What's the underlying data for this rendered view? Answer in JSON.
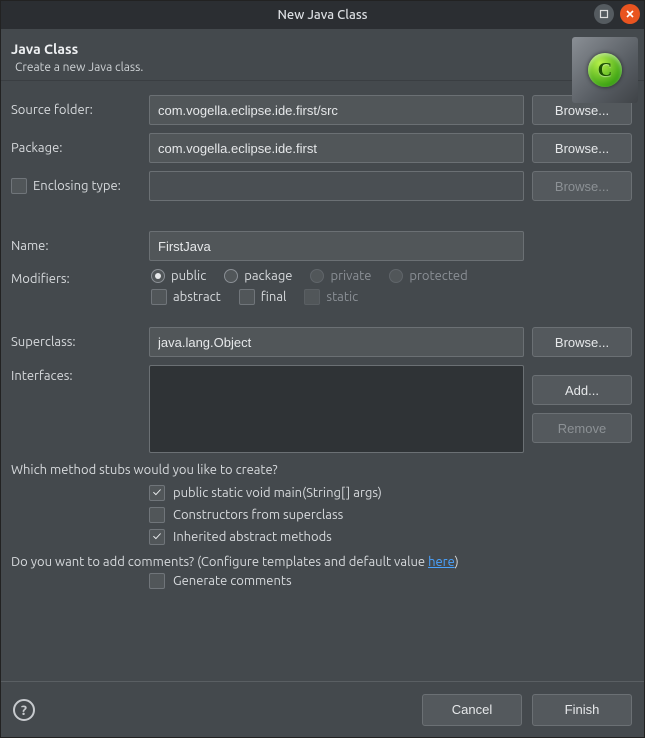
{
  "titlebar": {
    "title": "New Java Class"
  },
  "header": {
    "heading": "Java Class",
    "subtitle": "Create a new Java class.",
    "badge_letter": "C"
  },
  "labels": {
    "source_folder": "Source folder:",
    "package": "Package:",
    "enclosing_type": "Enclosing type:",
    "name": "Name:",
    "modifiers": "Modifiers:",
    "superclass": "Superclass:",
    "interfaces": "Interfaces:"
  },
  "fields": {
    "source_folder": "com.vogella.eclipse.ide.first/src",
    "package": "com.vogella.eclipse.ide.first",
    "enclosing_type": "",
    "name": "FirstJava",
    "superclass": "java.lang.Object"
  },
  "buttons": {
    "browse": "Browse...",
    "add": "Add...",
    "remove": "Remove",
    "cancel": "Cancel",
    "finish": "Finish"
  },
  "modifiers": {
    "visibility": {
      "public": "public",
      "package": "package",
      "private": "private",
      "protected": "protected",
      "selected": "public",
      "private_enabled": false,
      "protected_enabled": false
    },
    "abstract": {
      "label": "abstract",
      "checked": false
    },
    "final": {
      "label": "final",
      "checked": false
    },
    "static": {
      "label": "static",
      "checked": false,
      "enabled": false
    }
  },
  "stubs": {
    "question": "Which method stubs would you like to create?",
    "main": {
      "label": "public static void main(String[] args)",
      "checked": true
    },
    "constructors": {
      "label": "Constructors from superclass",
      "checked": false
    },
    "inherited": {
      "label": "Inherited abstract methods",
      "checked": true
    }
  },
  "comments": {
    "question_prefix": "Do you want to add comments? (Configure templates and default value ",
    "link_text": "here",
    "question_suffix": ")",
    "generate": {
      "label": "Generate comments",
      "checked": false
    }
  },
  "enclosing_checked": false
}
